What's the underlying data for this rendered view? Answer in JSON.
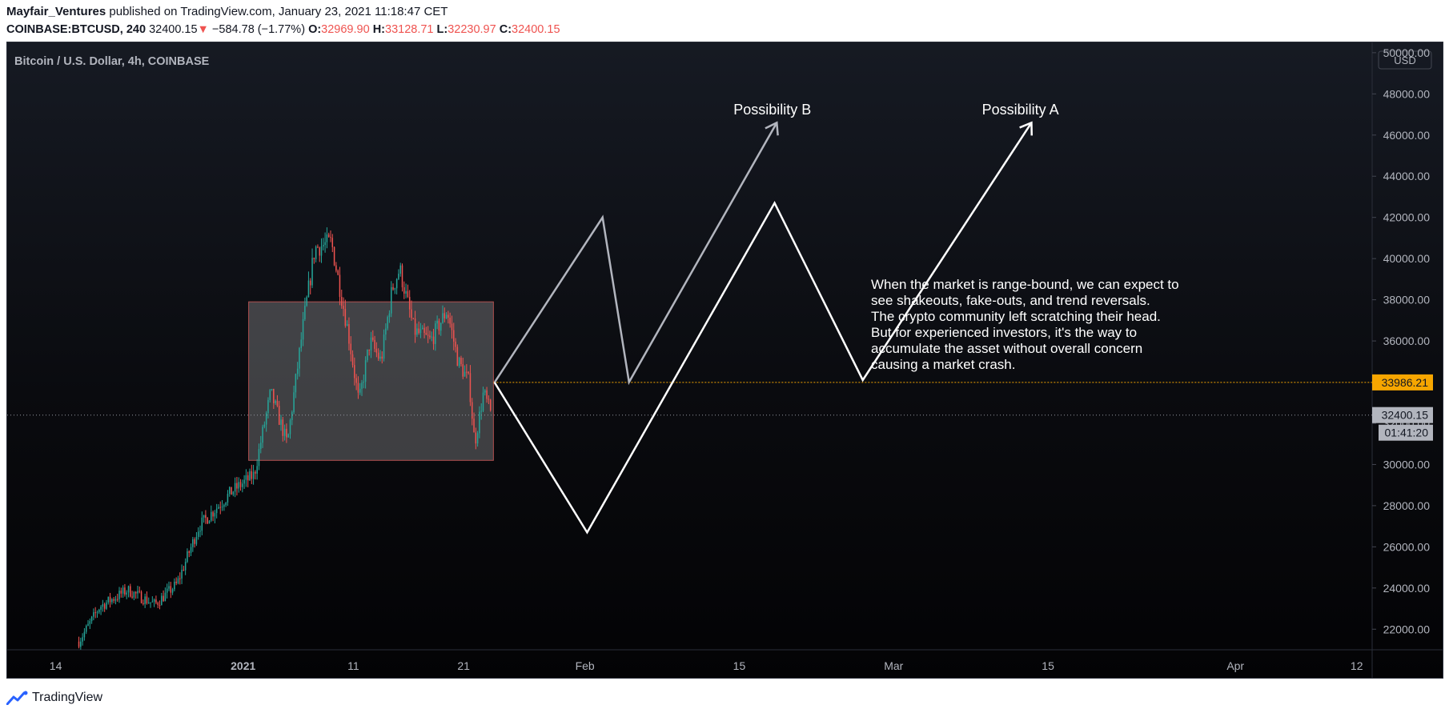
{
  "header": {
    "author": "Mayfair_Ventures",
    "published_text": " published on TradingView.com, January 23, 2021 11:18:47 CET",
    "symbol": "COINBASE:BTCUSD, 240",
    "last": "32400.15",
    "change_arrow": "▼",
    "change": "−584.78 (−1.77%)",
    "o_label": "O:",
    "o": "32969.90",
    "h_label": "H:",
    "h": "33128.71",
    "l_label": "L:",
    "l": "32230.97",
    "c_label": "C:",
    "c": "32400.15"
  },
  "chart_data": {
    "type": "candlestick",
    "title": "Bitcoin / U.S. Dollar, 4h, COINBASE",
    "currency_label": "USD",
    "y_range": [
      21000,
      50500
    ],
    "y_ticks": [
      "50000.00",
      "48000.00",
      "46000.00",
      "44000.00",
      "42000.00",
      "40000.00",
      "38000.00",
      "36000.00",
      "34000.00",
      "32000.00",
      "30000.00",
      "28000.00",
      "26000.00",
      "24000.00",
      "22000.00"
    ],
    "x_range_days": [
      -21.4,
      102.4
    ],
    "x_ticks": [
      {
        "label": "14",
        "day": -17
      },
      {
        "label": "2021",
        "day": 0,
        "bold": true
      },
      {
        "label": "11",
        "day": 10
      },
      {
        "label": "21",
        "day": 20
      },
      {
        "label": "Feb",
        "day": 31
      },
      {
        "label": "15",
        "day": 45
      },
      {
        "label": "Mar",
        "day": 59
      },
      {
        "label": "15",
        "day": 73
      },
      {
        "label": "Apr",
        "day": 90
      },
      {
        "label": "12",
        "day": 101
      }
    ],
    "price_path": [
      {
        "day": -14.9,
        "price": 21400
      },
      {
        "day": -13,
        "price": 23100
      },
      {
        "day": -10.5,
        "price": 23900
      },
      {
        "day": -8,
        "price": 23200
      },
      {
        "day": -6,
        "price": 24200
      },
      {
        "day": -4,
        "price": 27000
      },
      {
        "day": -1,
        "price": 28700
      },
      {
        "day": 1,
        "price": 29500
      },
      {
        "day": 2.5,
        "price": 33500
      },
      {
        "day": 4,
        "price": 31000
      },
      {
        "day": 5.5,
        "price": 37000
      },
      {
        "day": 6.5,
        "price": 40500
      },
      {
        "day": 8,
        "price": 40800
      },
      {
        "day": 9.5,
        "price": 36500
      },
      {
        "day": 10.5,
        "price": 33000
      },
      {
        "day": 11.5,
        "price": 36000
      },
      {
        "day": 12.5,
        "price": 35000
      },
      {
        "day": 13.5,
        "price": 38500
      },
      {
        "day": 14.2,
        "price": 39500
      },
      {
        "day": 15.5,
        "price": 36500
      },
      {
        "day": 17,
        "price": 36000
      },
      {
        "day": 18.5,
        "price": 37500
      },
      {
        "day": 19.5,
        "price": 35000
      },
      {
        "day": 20.5,
        "price": 34000
      },
      {
        "day": 21,
        "price": 31000
      },
      {
        "day": 21.8,
        "price": 33500
      },
      {
        "day": 22.5,
        "price": 32400
      }
    ],
    "range_box": {
      "day_from": 0.5,
      "day_to": 22.7,
      "price_from": 30200,
      "price_to": 37900
    },
    "level_line": {
      "price": 33986.21,
      "label": "33986.21",
      "color": "#f7a600"
    },
    "last_price": {
      "price": 32400.15,
      "label": "32400.15",
      "countdown": "01:41:20"
    },
    "projections": [
      {
        "name": "Possibility B",
        "points": [
          {
            "day": 22.8,
            "price": 33986
          },
          {
            "day": 32.6,
            "price": 42000
          },
          {
            "day": 35,
            "price": 34000
          },
          {
            "day": 48.4,
            "price": 46600
          }
        ],
        "color": "#b2b5be"
      },
      {
        "name": "Possibility A",
        "points": [
          {
            "day": 22.8,
            "price": 33986
          },
          {
            "day": 31.2,
            "price": 26700
          },
          {
            "day": 48.2,
            "price": 42700
          },
          {
            "day": 56.2,
            "price": 34100
          },
          {
            "day": 71.5,
            "price": 46600
          }
        ],
        "color": "#ffffff"
      }
    ],
    "labels": [
      {
        "text": "Possibility B",
        "day": 48,
        "price": 47000
      },
      {
        "text": "Possibility A",
        "day": 70.5,
        "price": 47000
      }
    ],
    "annotation": "When the market is range-bound, we can expect to see shakeouts, fake-outs, and trend reversals. The crypto community left scratching their head. But for experienced investors, it's the way to accumulate the asset without overall concern causing a market crash."
  },
  "footer": {
    "brand": "TradingView"
  }
}
